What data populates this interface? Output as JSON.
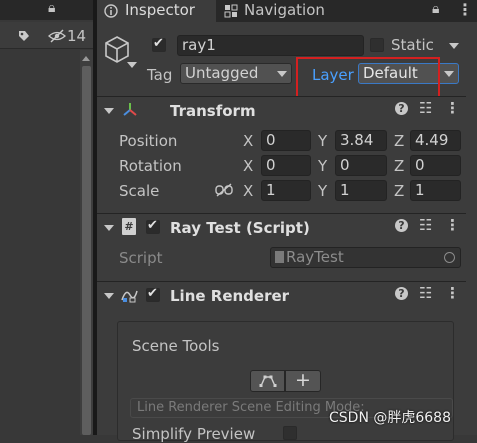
{
  "left_panel": {
    "lock_glyph": "⌂",
    "tag_icon": "tag-icon",
    "hidden_count": "14"
  },
  "tabs": {
    "inspector": "Inspector",
    "navigation": "Navigation"
  },
  "object": {
    "active": true,
    "name": "ray1",
    "static_label": "Static",
    "static_checked": false,
    "tag_label": "Tag",
    "tag_value": "Untagged",
    "layer_label": "Layer",
    "layer_value": "Default"
  },
  "transform": {
    "title": "Transform",
    "position_label": "Position",
    "rotation_label": "Rotation",
    "scale_label": "Scale",
    "axis_x": "X",
    "axis_y": "Y",
    "axis_z": "Z",
    "position": {
      "x": "0",
      "y": "3.84",
      "z": "4.49"
    },
    "rotation": {
      "x": "0",
      "y": "0",
      "z": "0"
    },
    "scale": {
      "x": "1",
      "y": "1",
      "z": "1"
    }
  },
  "ray_test": {
    "title": "Ray Test (Script)",
    "enabled": true,
    "script_label": "Script",
    "script_value": "RayTest"
  },
  "line_renderer": {
    "title": "Line Renderer",
    "enabled": true,
    "scene_tools_label": "Scene Tools",
    "plus_label": "+",
    "mode_text": "Line Renderer Scene Editing Mode:",
    "simplify_label": "Simplify Preview"
  },
  "watermark": "CSDN @胖虎6688",
  "colors": {
    "highlight_box": "#d42020",
    "layer_label": "#4aa0ff"
  }
}
